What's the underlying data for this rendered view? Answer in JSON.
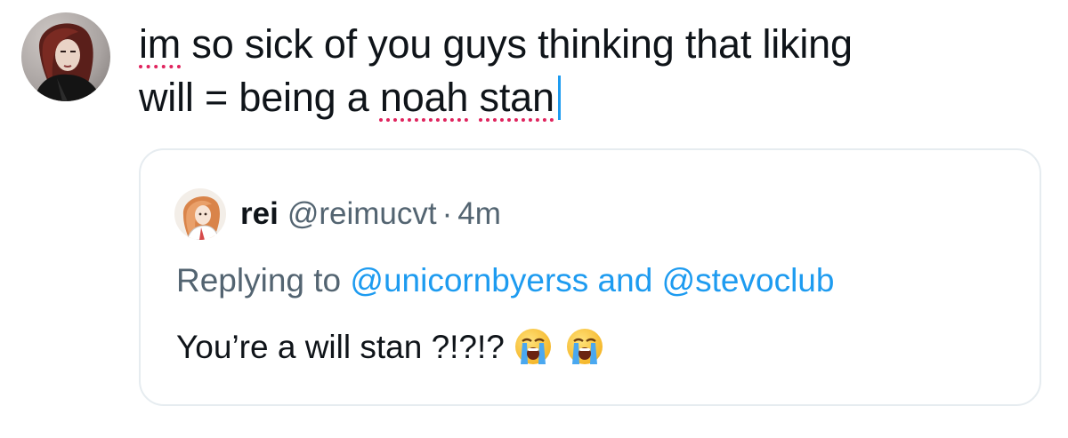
{
  "compose": {
    "line1_word1": "im",
    "line1_rest": " so sick of you guys thinking that liking",
    "line2_start": "will = being a ",
    "line2_word1": "noah",
    "line2_space": " ",
    "line2_word2": "stan"
  },
  "quote": {
    "name": "rei",
    "handle": "@reimucvt",
    "separator": "·",
    "time": "4m",
    "replying_prefix": "Replying to ",
    "mention1": "@unicornbyerss",
    "replying_and": " and ",
    "mention2": "@stevoclub",
    "body_text": "You’re a will stan ?!?!?",
    "emojis": [
      "loudly-crying-face",
      "loudly-crying-face"
    ]
  },
  "colors": {
    "accent": "#1d9bf0",
    "text": "#0f1419",
    "secondary": "#536471",
    "spellcheck": "#e0245e",
    "border": "#e6ecf0"
  }
}
